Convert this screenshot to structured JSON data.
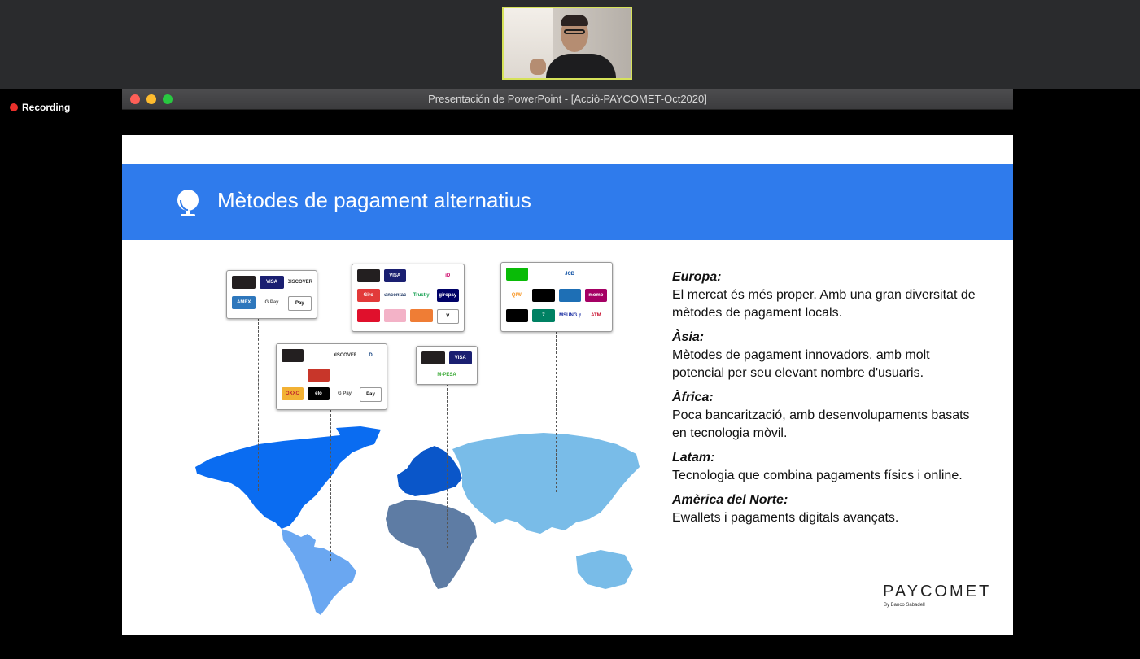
{
  "status": {
    "recording": "Recording"
  },
  "window": {
    "title": "Presentación de PowerPoint - [Acciò-PAYCOMET-Oct2020]"
  },
  "slide": {
    "title": "Mètodes de pagament alternatius",
    "regions": [
      {
        "heading": "Europa:",
        "body": "El mercat és més proper. Amb una gran diversitat de mètodes de pagament locals."
      },
      {
        "heading": "Àsia:",
        "body": "Mètodes de pagament innovadors, amb molt potencial per seu elevant nombre d'usuaris."
      },
      {
        "heading": "Àfrica:",
        "body": "Poca bancarització, amb desenvolupaments basats en tecnologia mòvil."
      },
      {
        "heading": "Latam:",
        "body": "Tecnologia que combina pagaments físics i online."
      },
      {
        "heading": "Amèrica del Norte:",
        "body": "Ewallets i pagaments digitals avançats."
      }
    ],
    "logo": {
      "name": "PAYCOMET",
      "subtitle": "By Banco Sabadell"
    },
    "cards": {
      "north_america": [
        "",
        "VISA",
        "DISCOVER",
        "AMEX",
        "G Pay",
        "Pay"
      ],
      "latam": [
        "",
        "",
        "DISCOVER",
        "D",
        "",
        "",
        "",
        "",
        "OXXO",
        "elo",
        "G Pay",
        "Pay"
      ],
      "europe": [
        "",
        "VISA",
        "",
        "iD",
        "Giro",
        "bancontact",
        "Trustly",
        "giropay",
        "",
        "",
        "",
        "V"
      ],
      "africa": [
        "",
        "VISA",
        "M-PESA"
      ],
      "asia": [
        "",
        "",
        "JCB",
        "",
        "QIWI",
        "",
        "",
        "momo",
        "",
        "7",
        "SAMSUNG pay",
        "ATM"
      ]
    }
  },
  "colors": {
    "banner": "#2f7bec",
    "north_america": "#0a6cf1",
    "latam": "#6aa7f1",
    "europe": "#0a56c9",
    "africa": "#5e7ca4",
    "asia": "#79bce8"
  }
}
